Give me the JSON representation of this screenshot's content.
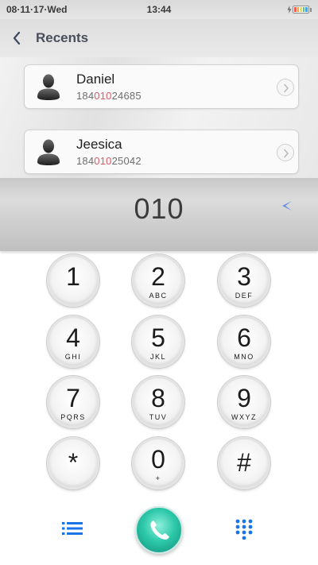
{
  "status_bar": {
    "date": "08·11·17·Wed",
    "time": "13:44",
    "battery_colors": [
      "#e85a5a",
      "#f2a23a",
      "#e8e04a",
      "#5cc46a",
      "#4aa0e8"
    ]
  },
  "recents": {
    "title": "Recents",
    "back_icon": "chevron-left-icon",
    "contacts": [
      {
        "name": "Daniel",
        "number_prefix": "184",
        "number_match": "010",
        "number_suffix": "24685"
      },
      {
        "name": "Jeesica",
        "number_prefix": "184",
        "number_match": "010",
        "number_suffix": "25042"
      }
    ]
  },
  "dialer": {
    "number": "010",
    "backspace_icon": "backspace-arrow-icon"
  },
  "keypad": {
    "keys": [
      {
        "digit": "1",
        "letters": ""
      },
      {
        "digit": "2",
        "letters": "ABC"
      },
      {
        "digit": "3",
        "letters": "DEF"
      },
      {
        "digit": "4",
        "letters": "GHI"
      },
      {
        "digit": "5",
        "letters": "JKL"
      },
      {
        "digit": "6",
        "letters": "MNO"
      },
      {
        "digit": "7",
        "letters": "PQRS"
      },
      {
        "digit": "8",
        "letters": "TUV"
      },
      {
        "digit": "9",
        "letters": "WXYZ"
      },
      {
        "digit": "*",
        "letters": ""
      },
      {
        "digit": "0",
        "letters": "+"
      },
      {
        "digit": "#",
        "letters": ""
      }
    ]
  },
  "bottom_bar": {
    "left_icon": "menu-list-icon",
    "center_icon": "phone-call-icon",
    "right_icon": "dialpad-grid-icon",
    "accent_color": "#1a73e8",
    "call_color": "#2ec9aa"
  }
}
